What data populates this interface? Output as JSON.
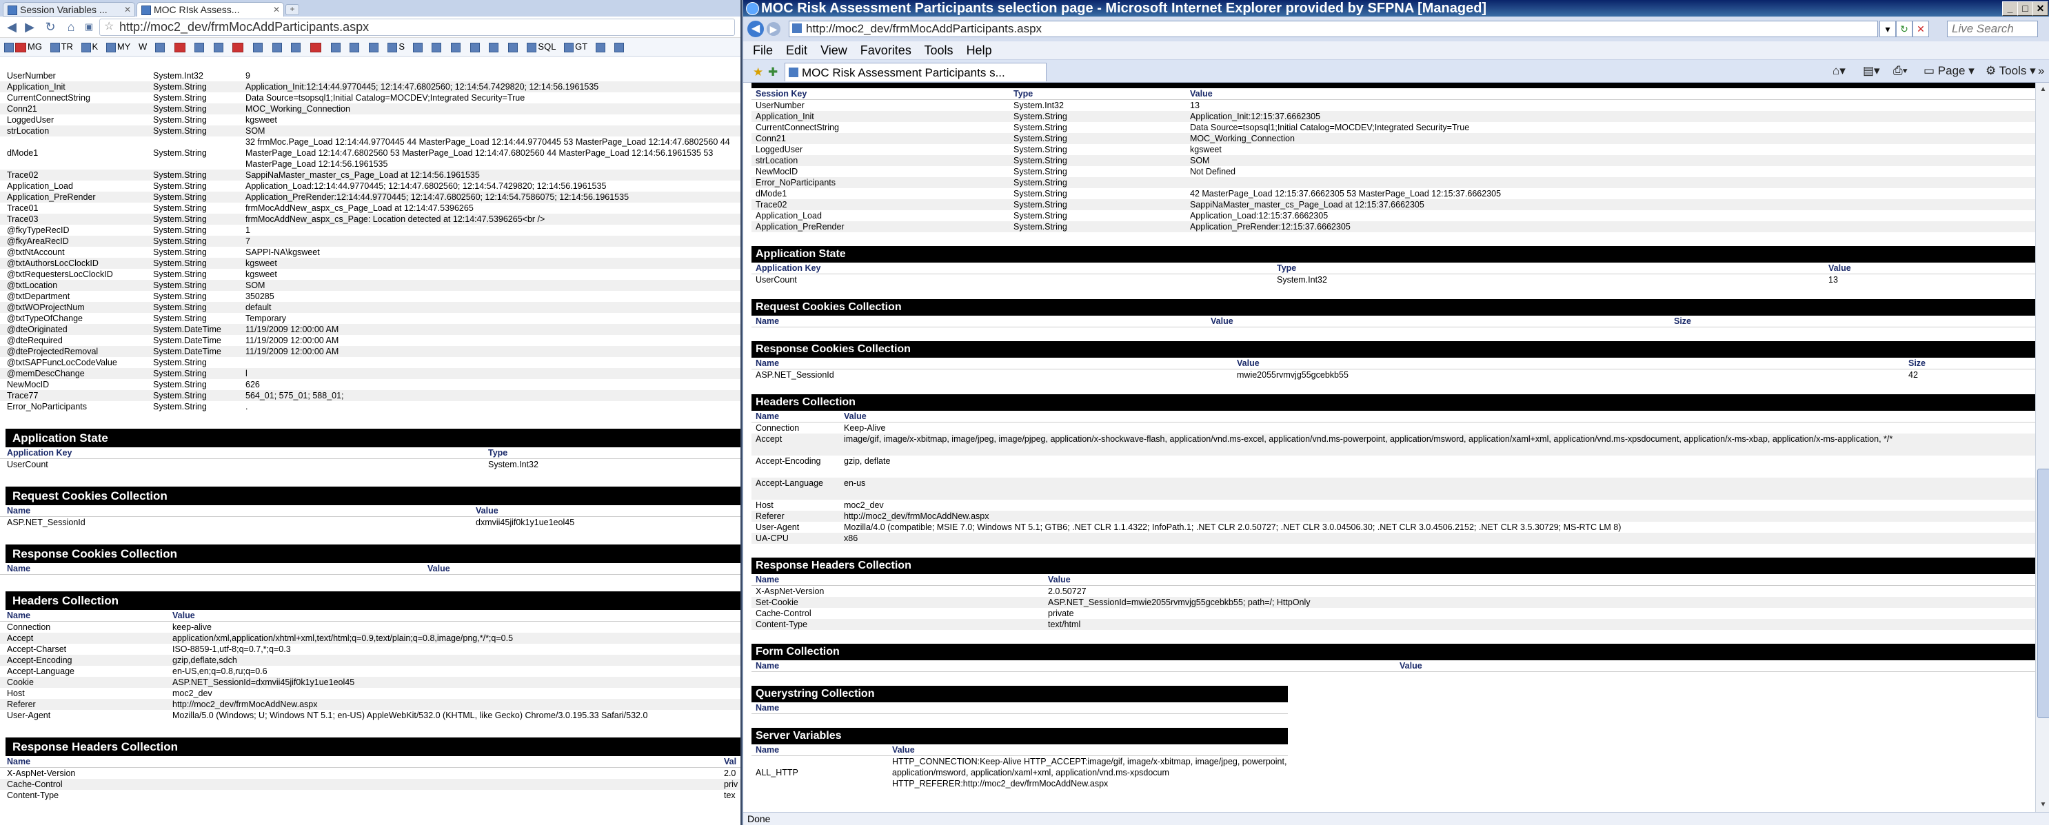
{
  "chrome": {
    "tabs": [
      {
        "label": "Session Variables ..."
      },
      {
        "label": "MOC RIsk Assess..."
      }
    ],
    "new_tab_label": "+",
    "url": "http://moc2_dev/frmMocAddParticipants.aspx",
    "bookmarks": [
      "MG",
      "TR",
      "K",
      "MY",
      "W",
      "S",
      "SQL",
      "GT"
    ],
    "session_state": {
      "rows": [
        {
          "key": "UserNumber",
          "type": "System.Int32",
          "value": "9"
        },
        {
          "key": "Application_Init",
          "type": "System.String",
          "value": "Application_Init:12:14:44.9770445; 12:14:47.6802560; 12:14:54.7429820; 12:14:56.1961535"
        },
        {
          "key": "CurrentConnectString",
          "type": "System.String",
          "value": "Data Source=tsopsql1;Initial Catalog=MOCDEV;Integrated Security=True"
        },
        {
          "key": "Conn21",
          "type": "System.String",
          "value": "MOC_Working_Connection"
        },
        {
          "key": "LoggedUser",
          "type": "System.String",
          "value": "kgsweet"
        },
        {
          "key": "strLocation",
          "type": "System.String",
          "value": "SOM"
        },
        {
          "key": "dMode1",
          "type": "System.String",
          "value": "32 frmMoc.Page_Load 12:14:44.9770445  44 MasterPage_Load 12:14:44.9770445  53 MasterPage_Load 12:14:47.6802560  44 MasterPage_Load 12:14:47.6802560  53 MasterPage_Load 12:14:47.6802560  44 MasterPage_Load 12:14:56.1961535  53 MasterPage_Load 12:14:56.1961535",
          "lines": 3
        },
        {
          "key": "Trace02",
          "type": "System.String",
          "value": "SappiNaMaster_master_cs_Page_Load at 12:14:56.1961535"
        },
        {
          "key": "Application_Load",
          "type": "System.String",
          "value": "Application_Load:12:14:44.9770445; 12:14:47.6802560; 12:14:54.7429820; 12:14:56.1961535"
        },
        {
          "key": "Application_PreRender",
          "type": "System.String",
          "value": "Application_PreRender:12:14:44.9770445; 12:14:47.6802560; 12:14:54.7586075; 12:14:56.1961535"
        },
        {
          "key": "Trace01",
          "type": "System.String",
          "value": "frmMocAddNew_aspx_cs_Page_Load at 12:14:47.5396265"
        },
        {
          "key": "Trace03",
          "type": "System.String",
          "value": "frmMocAddNew_aspx_cs_Page: Location detected at 12:14:47.5396265<br />"
        },
        {
          "key": "@fkyTypeRecID",
          "type": "System.String",
          "value": "1"
        },
        {
          "key": "@fkyAreaRecID",
          "type": "System.String",
          "value": "7"
        },
        {
          "key": "@txtNtAccount",
          "type": "System.String",
          "value": "SAPPI-NA\\kgsweet"
        },
        {
          "key": "@txtAuthorsLocClockID",
          "type": "System.String",
          "value": "kgsweet"
        },
        {
          "key": "@txtRequestersLocClockID",
          "type": "System.String",
          "value": "kgsweet"
        },
        {
          "key": "@txtLocation",
          "type": "System.String",
          "value": "SOM"
        },
        {
          "key": "@txtDepartment",
          "type": "System.String",
          "value": "350285"
        },
        {
          "key": "@txtWOProjectNum",
          "type": "System.String",
          "value": "default"
        },
        {
          "key": "@txtTypeOfChange",
          "type": "System.String",
          "value": "Temporary"
        },
        {
          "key": "@dteOriginated",
          "type": "System.DateTime",
          "value": "11/19/2009 12:00:00 AM"
        },
        {
          "key": "@dteRequired",
          "type": "System.DateTime",
          "value": "11/19/2009 12:00:00 AM"
        },
        {
          "key": "@dteProjectedRemoval",
          "type": "System.DateTime",
          "value": "11/19/2009 12:00:00 AM"
        },
        {
          "key": "@txtSAPFuncLocCodeValue",
          "type": "System.String",
          "value": ""
        },
        {
          "key": "@memDescChange",
          "type": "System.String",
          "value": "l"
        },
        {
          "key": "NewMocID",
          "type": "System.String",
          "value": "626"
        },
        {
          "key": "Trace77",
          "type": "System.String",
          "value": "564_01; 575_01; 588_01;"
        },
        {
          "key": "Error_NoParticipants",
          "type": "System.String",
          "value": "."
        }
      ]
    },
    "application_state": {
      "title": "Application State",
      "headers": [
        "Application Key",
        "Type"
      ],
      "rows": [
        {
          "key": "UserCount",
          "type": "System.Int32"
        }
      ]
    },
    "request_cookies": {
      "title": "Request Cookies Collection",
      "headers": [
        "Name",
        "Value"
      ],
      "rows": [
        {
          "name": "ASP.NET_SessionId",
          "value": "dxmvii45jif0k1y1ue1eol45"
        }
      ]
    },
    "response_cookies": {
      "title": "Response Cookies Collection",
      "headers": [
        "Name",
        "Value"
      ]
    },
    "headers": {
      "title": "Headers Collection",
      "headers": [
        "Name",
        "Value"
      ],
      "rows": [
        {
          "name": "Connection",
          "value": "keep-alive"
        },
        {
          "name": "Accept",
          "value": "application/xml,application/xhtml+xml,text/html;q=0.9,text/plain;q=0.8,image/png,*/*;q=0.5"
        },
        {
          "name": "Accept-Charset",
          "value": "ISO-8859-1,utf-8;q=0.7,*;q=0.3"
        },
        {
          "name": "Accept-Encoding",
          "value": "gzip,deflate,sdch"
        },
        {
          "name": "Accept-Language",
          "value": "en-US,en;q=0.8,ru;q=0.6"
        },
        {
          "name": "Cookie",
          "value": "ASP.NET_SessionId=dxmvii45jif0k1y1ue1eol45"
        },
        {
          "name": "Host",
          "value": "moc2_dev"
        },
        {
          "name": "Referer",
          "value": "http://moc2_dev/frmMocAddNew.aspx"
        },
        {
          "name": "User-Agent",
          "value": "Mozilla/5.0 (Windows; U; Windows NT 5.1; en-US) AppleWebKit/532.0 (KHTML, like Gecko) Chrome/3.0.195.33 Safari/532.0"
        }
      ]
    },
    "response_headers": {
      "title": "Response Headers Collection",
      "headers": [
        "Name",
        "Val"
      ],
      "rows": [
        {
          "name": "X-AspNet-Version",
          "value": "2.0"
        },
        {
          "name": "Cache-Control",
          "value": "priv"
        },
        {
          "name": "Content-Type",
          "value": "tex"
        }
      ]
    }
  },
  "ie": {
    "title": "MOC Risk Assessment Participants selection page - Microsoft Internet Explorer provided by SFPNA [Managed]",
    "url": "http://moc2_dev/frmMocAddParticipants.aspx",
    "search_placeholder": "Live Search",
    "menu": [
      "File",
      "Edit",
      "View",
      "Favorites",
      "Tools",
      "Help"
    ],
    "tab_label": "MOC Risk Assessment Participants s...",
    "commands": {
      "page": "Page",
      "tools": "Tools"
    },
    "status": "Done",
    "session_state": {
      "headers": [
        "Session Key",
        "Type",
        "Value"
      ],
      "rows": [
        {
          "key": "UserNumber",
          "type": "System.Int32",
          "value": "13"
        },
        {
          "key": "Application_Init",
          "type": "System.String",
          "value": "Application_Init:12:15:37.6662305"
        },
        {
          "key": "CurrentConnectString",
          "type": "System.String",
          "value": "Data Source=tsopsql1;Initial Catalog=MOCDEV;Integrated Security=True"
        },
        {
          "key": "Conn21",
          "type": "System.String",
          "value": "MOC_Working_Connection"
        },
        {
          "key": "LoggedUser",
          "type": "System.String",
          "value": "kgsweet"
        },
        {
          "key": "strLocation",
          "type": "System.String",
          "value": "SOM"
        },
        {
          "key": "NewMocID",
          "type": "System.String",
          "value": "Not Defined"
        },
        {
          "key": "Error_NoParticipants",
          "type": "System.String",
          "value": ""
        },
        {
          "key": "dMode1",
          "type": "System.String",
          "value": "42 MasterPage_Load 12:15:37.6662305  53 MasterPage_Load 12:15:37.6662305"
        },
        {
          "key": "Trace02",
          "type": "System.String",
          "value": "SappiNaMaster_master_cs_Page_Load at 12:15:37.6662305"
        },
        {
          "key": "Application_Load",
          "type": "System.String",
          "value": "Application_Load:12:15:37.6662305"
        },
        {
          "key": "Application_PreRender",
          "type": "System.String",
          "value": "Application_PreRender:12:15:37.6662305"
        }
      ]
    },
    "application_state": {
      "title": "Application State",
      "headers": [
        "Application Key",
        "Type",
        "Value"
      ],
      "rows": [
        {
          "key": "UserCount",
          "type": "System.Int32",
          "value": "13"
        }
      ]
    },
    "request_cookies": {
      "title": "Request Cookies Collection",
      "headers": [
        "Name",
        "Value",
        "Size"
      ]
    },
    "response_cookies": {
      "title": "Response Cookies Collection",
      "headers": [
        "Name",
        "Value",
        "Size"
      ],
      "rows": [
        {
          "name": "ASP.NET_SessionId",
          "value": "mwie2055rvmvjg55gcebkb55",
          "size": "42"
        }
      ]
    },
    "headers": {
      "title": "Headers Collection",
      "headers": [
        "Name",
        "Value"
      ],
      "rows": [
        {
          "name": "Connection",
          "value": "Keep-Alive"
        },
        {
          "name": "Accept",
          "value": "image/gif, image/x-xbitmap, image/jpeg, image/pjpeg, application/x-shockwave-flash, application/vnd.ms-excel, application/vnd.ms-powerpoint, application/msword, application/xaml+xml, application/vnd.ms-xpsdocument, application/x-ms-xbap, application/x-ms-application, */*",
          "lines": 2
        },
        {
          "name": "Accept-Encoding",
          "value": "gzip, deflate",
          "lines": 2
        },
        {
          "name": "Accept-Language",
          "value": "en-us",
          "lines": 2
        },
        {
          "name": "Host",
          "value": "moc2_dev"
        },
        {
          "name": "Referer",
          "value": "http://moc2_dev/frmMocAddNew.aspx"
        },
        {
          "name": "User-Agent",
          "value": "Mozilla/4.0 (compatible; MSIE 7.0; Windows NT 5.1; GTB6; .NET CLR 1.1.4322; InfoPath.1; .NET CLR 2.0.50727; .NET CLR 3.0.04506.30; .NET CLR 3.0.4506.2152; .NET CLR 3.5.30729; MS-RTC LM 8)"
        },
        {
          "name": "UA-CPU",
          "value": "x86"
        }
      ]
    },
    "response_headers": {
      "title": "Response Headers Collection",
      "headers": [
        "Name",
        "Value"
      ],
      "rows": [
        {
          "name": "X-AspNet-Version",
          "value": "2.0.50727"
        },
        {
          "name": "Set-Cookie",
          "value": "ASP.NET_SessionId=mwie2055rvmvjg55gcebkb55; path=/; HttpOnly"
        },
        {
          "name": "Cache-Control",
          "value": "private"
        },
        {
          "name": "Content-Type",
          "value": "text/html"
        }
      ]
    },
    "form": {
      "title": "Form Collection",
      "headers": [
        "Name",
        "Value"
      ]
    },
    "querystring": {
      "title": "Querystring Collection",
      "headers": [
        "Name"
      ]
    },
    "server_variables": {
      "title": "Server Variables",
      "headers": [
        "Name",
        "Value"
      ],
      "rows": [
        {
          "name": "ALL_HTTP",
          "value": "HTTP_CONNECTION:Keep-Alive HTTP_ACCEPT:image/gif, image/x-xbitmap, image/jpeg, powerpoint, application/msword, application/xaml+xml, application/vnd.ms-xpsdocum HTTP_REFERER:http://moc2_dev/frmMocAddNew.aspx"
        }
      ]
    }
  }
}
